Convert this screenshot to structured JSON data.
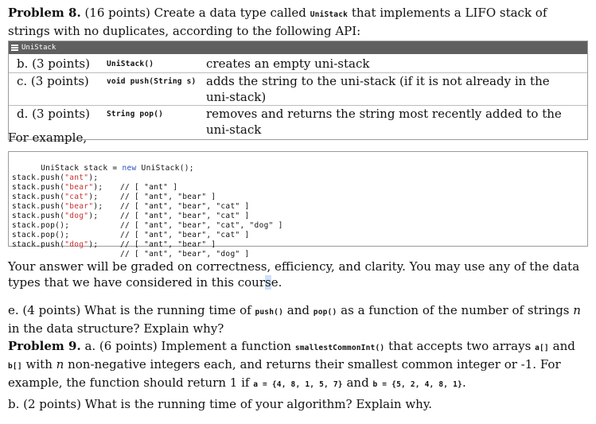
{
  "problem8": {
    "heading": "Problem 8.",
    "intro_before": "(16 points) Create a data type called",
    "type_name": "UniStack",
    "intro_after": "that implements a LIFO stack of strings with no duplicates, according to the following API:"
  },
  "api": {
    "header_label": "UniStack",
    "rows": [
      {
        "part": "b. (3 points)",
        "signature": "UniStack()",
        "description": "creates an empty uni-stack"
      },
      {
        "part": "c. (3 points)",
        "signature": "void push(String s)",
        "description": "adds the string to the uni-stack (if it is not already in the uni-stack)"
      },
      {
        "part": "d. (3 points)",
        "signature": "String pop()",
        "description": "removes and returns the string most recently added to the uni-stack"
      }
    ]
  },
  "for_example": "For example,",
  "code": {
    "line0": {
      "pre": "UniStack stack = ",
      "kw": "new",
      "post": " UniStack();"
    },
    "lines": [
      {
        "fn": "stack.push(",
        "arg": "\"ant\"",
        "end": ");",
        "comment": "// [ \"ant\" ]"
      },
      {
        "fn": "stack.push(",
        "arg": "\"bear\"",
        "end": ");",
        "comment": "// [ \"ant\", \"bear\" ]"
      },
      {
        "fn": "stack.push(",
        "arg": "\"cat\"",
        "end": ");",
        "comment": "// [ \"ant\", \"bear\", \"cat\" ]"
      },
      {
        "fn": "stack.push(",
        "arg": "\"bear\"",
        "end": ");",
        "comment": "// [ \"ant\", \"bear\", \"cat\" ]"
      },
      {
        "fn": "stack.push(",
        "arg": "\"dog\"",
        "end": ");",
        "comment": "// [ \"ant\", \"bear\", \"cat\", \"dog\" ]"
      },
      {
        "fn": "stack.pop();",
        "arg": "",
        "end": "",
        "comment": "// [ \"ant\", \"bear\", \"cat\" ]"
      },
      {
        "fn": "stack.pop();",
        "arg": "",
        "end": "",
        "comment": "// [ \"ant\", \"bear\" ]"
      },
      {
        "fn": "stack.push(",
        "arg": "\"dog\"",
        "end": ");",
        "comment": "// [ \"ant\", \"bear\", \"dog\" ]"
      }
    ]
  },
  "grading": {
    "text_before": "Your answer will be graded on correctness, efficiency, and clarity. You may use any of the data types that we have considered in this cour",
    "text_mid": "s",
    "text_after": "e."
  },
  "part_e": {
    "t1": "e. (4 points) What is the running time of",
    "push": "push()",
    "t2": "and",
    "pop": "pop()",
    "t3": "as a function of the number of strings",
    "n": "n",
    "t4": "in the data structure? Explain why?"
  },
  "problem9": {
    "heading": "Problem 9.",
    "t1": "a. (6 points) Implement a function",
    "fn": "smallestCommonInt()",
    "t2": "that accepts two arrays",
    "a": "a[]",
    "t3": "and",
    "b": "b[]",
    "t4": "with",
    "n": "n",
    "t5": "non-negative integers each, and returns their smallest common integer or -1. For example, the function should return 1 if",
    "a_val": "a = {4, 8, 1, 5, 7}",
    "t6": "and",
    "b_val": "b = {5, 2, 4, 8, 1}",
    "t7": ".",
    "partb": "b. (2 points) What is the running time of your algorithm? Explain why."
  }
}
